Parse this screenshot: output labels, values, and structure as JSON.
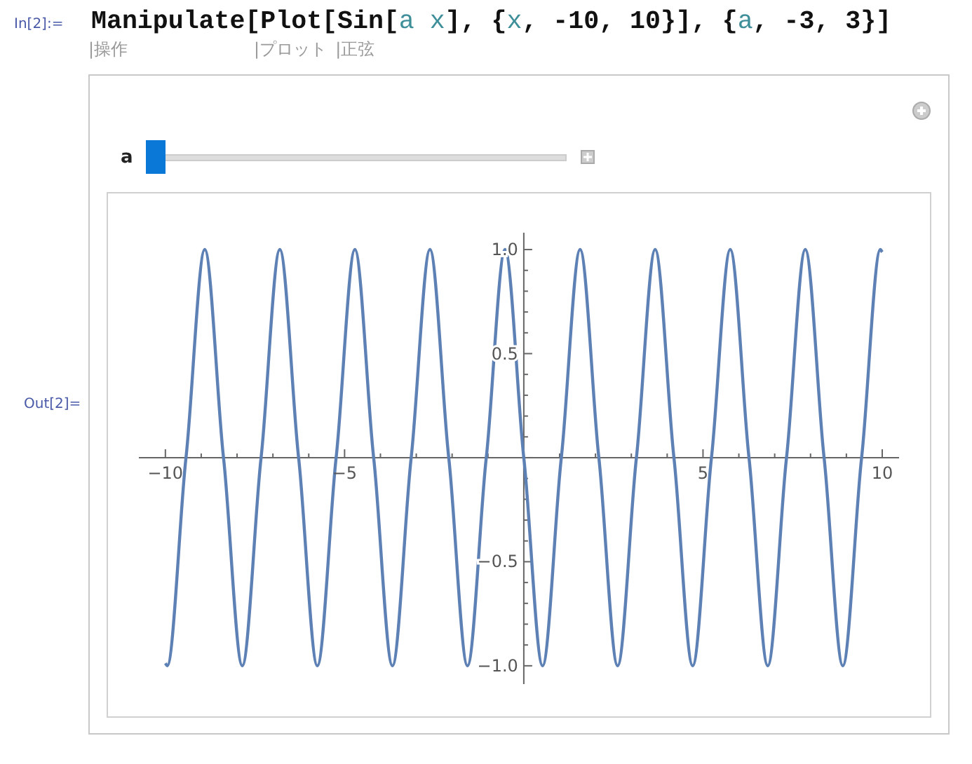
{
  "input_label": "In[2]:=",
  "code": [
    {
      "text": "Manipulate[Plot[Sin[",
      "kind": "symbol"
    },
    {
      "text": "a x",
      "kind": "variable"
    },
    {
      "text": "], {",
      "kind": "symbol"
    },
    {
      "text": "x",
      "kind": "variable"
    },
    {
      "text": ", -10, 10}], {",
      "kind": "symbol"
    },
    {
      "text": "a",
      "kind": "variable"
    },
    {
      "text": ", -3, 3}]",
      "kind": "symbol"
    }
  ],
  "annotations": [
    {
      "text": "|操作"
    },
    {
      "text": "|プロット"
    },
    {
      "text": "|正弦"
    }
  ],
  "output_label": "Out[2]=",
  "manipulate": {
    "slider": {
      "label": "a",
      "level": 0
    },
    "plot": {
      "chart_data": {
        "type": "line",
        "xlim": [
          -10.74,
          10.47
        ],
        "ylim": [
          -1.088,
          1.081
        ],
        "xticks": [
          {
            "value": -10,
            "label": "−10"
          },
          {
            "value": -5,
            "label": "−5"
          },
          {
            "value": 5,
            "label": "5"
          },
          {
            "value": 10,
            "label": "10"
          }
        ],
        "yticks": [
          {
            "value": -1,
            "label": "−1.0"
          },
          {
            "value": -0.5,
            "label": "−0.5"
          },
          {
            "value": 0.5,
            "label": "0.5"
          },
          {
            "value": 1,
            "label": "1.0"
          }
        ],
        "x": [
          -10,
          -9.948,
          -9.425,
          -8.901,
          -8.378,
          -7.854,
          -7.33,
          -6.807,
          -6.283,
          -5.76,
          -5.236,
          -4.712,
          -4.189,
          -3.665,
          -3.142,
          -2.618,
          -2.094,
          -1.571,
          -1.047,
          -0.524,
          0,
          0.524,
          1.047,
          1.571,
          2.094,
          2.618,
          3.142,
          3.665,
          4.189,
          4.712,
          5.236,
          5.76,
          6.283,
          6.807,
          7.33,
          7.854,
          8.378,
          8.901,
          9.425,
          9.948,
          10
        ],
        "series": [
          {
            "color": "#5e81b5",
            "values": [
              -0.988,
              -1,
              0,
              1,
              0,
              -1,
              0,
              1,
              0,
              -1,
              0,
              1,
              0,
              -1,
              0,
              1,
              0,
              -1,
              0,
              1,
              0,
              -1,
              0,
              1,
              0,
              -1,
              0,
              1,
              0,
              -1,
              0,
              1,
              0,
              -1,
              0,
              1,
              0,
              -1,
              0,
              1,
              0.988
            ]
          }
        ]
      }
    }
  }
}
